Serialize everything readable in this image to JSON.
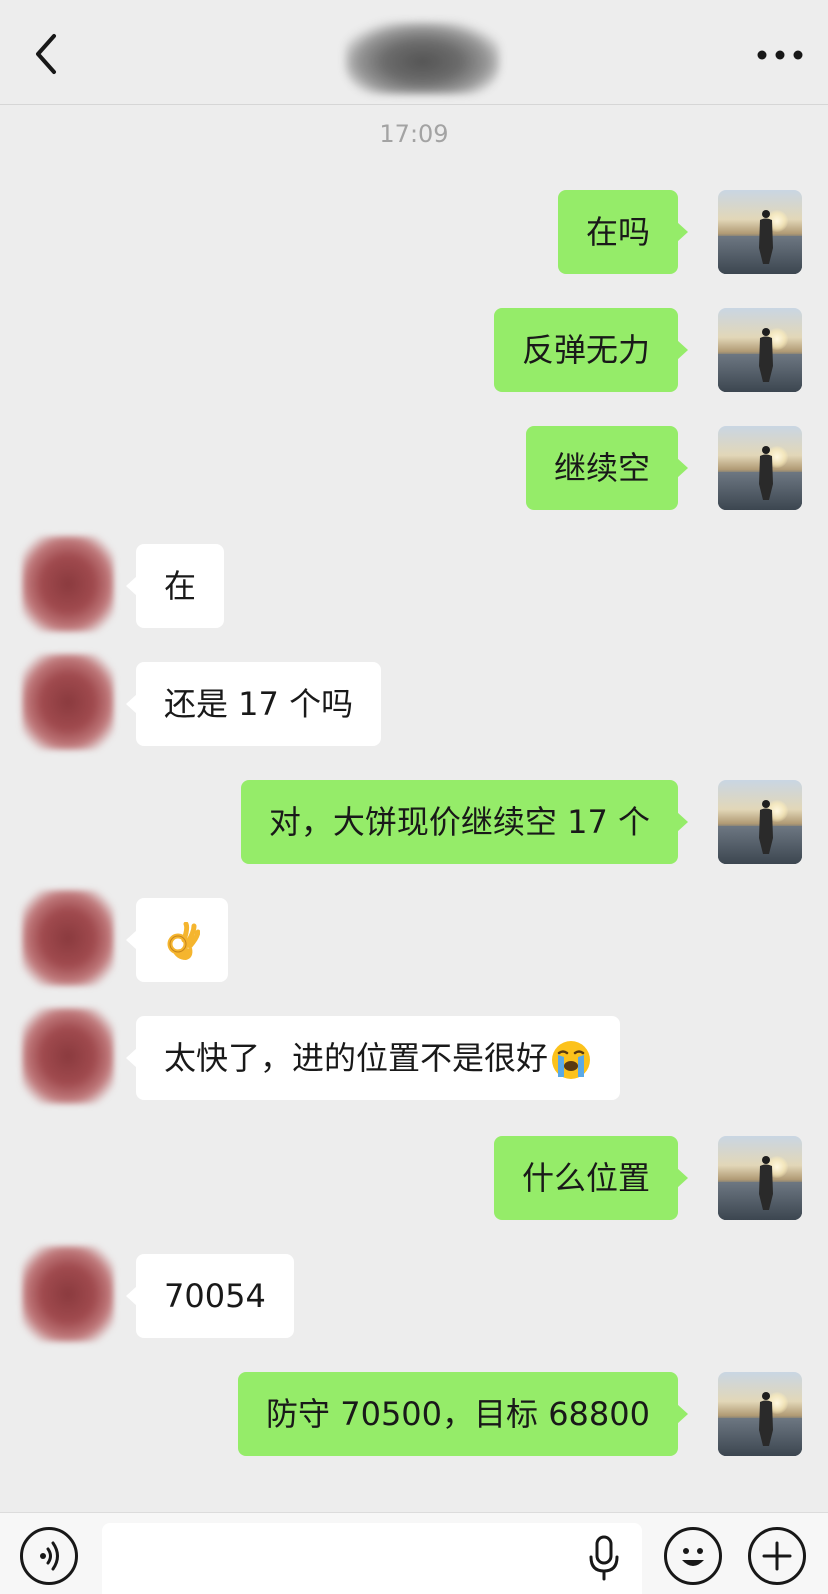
{
  "header": {
    "back_icon": "chevron-left-icon",
    "more_icon": "more-horizontal-icon"
  },
  "timestamp": "17:09",
  "messages": [
    {
      "side": "self",
      "text": "在吗"
    },
    {
      "side": "self",
      "text": "反弹无力"
    },
    {
      "side": "self",
      "text": "继续空"
    },
    {
      "side": "other",
      "text": "在"
    },
    {
      "side": "other",
      "text": "还是 17 个吗"
    },
    {
      "side": "self",
      "text": "对，大饼现价继续空 17 个"
    },
    {
      "side": "other",
      "text": "",
      "emoji": "ok-hand-emoji"
    },
    {
      "side": "other",
      "text": "太快了，进的位置不是很好",
      "emoji": "loudly-crying-emoji"
    },
    {
      "side": "self",
      "text": "什么位置"
    },
    {
      "side": "other",
      "text": "70054"
    },
    {
      "side": "self",
      "text": "防守 70500，目标 68800"
    }
  ],
  "input_bar": {
    "value": "",
    "voice_icon": "voice-icon",
    "mic_icon": "microphone-icon",
    "emoji_icon": "emoji-icon",
    "plus_icon": "plus-icon"
  },
  "colors": {
    "background": "#ededed",
    "self_bubble": "#95ec69",
    "other_bubble": "#ffffff",
    "text": "#191919",
    "timestamp": "#a3a3a3"
  }
}
